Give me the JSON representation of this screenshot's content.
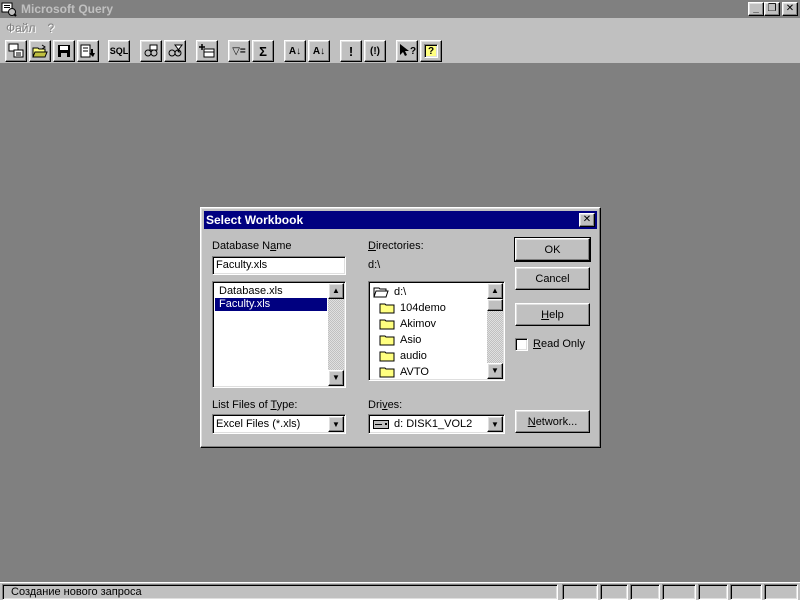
{
  "app": {
    "title": "Microsoft Query"
  },
  "window_buttons": {
    "minimize": "_",
    "restore": "❐",
    "close": "✕"
  },
  "menu": {
    "items": [
      {
        "label": "Файл"
      },
      {
        "label": "?"
      }
    ]
  },
  "toolbar": {
    "sql_label": "SQL",
    "filter_label": "▽=",
    "sigma_label": "Σ",
    "sort_asc_label": "A↓",
    "sort_desc_label": "A↓",
    "exec_label": "!",
    "auto_label": "(!)",
    "help_pointer_label": "?",
    "help_label": "?"
  },
  "dialog": {
    "title": "Select Workbook",
    "close_glyph": "✕",
    "database_name_label_pre": "Database N",
    "database_name_label_u": "a",
    "database_name_label_post": "me",
    "database_name_value": "Faculty.xls",
    "files": [
      {
        "name": "Database.xls",
        "selected": false
      },
      {
        "name": "Faculty.xls",
        "selected": true
      }
    ],
    "directories_label_u": "D",
    "directories_label_post": "irectories:",
    "current_dir": "d:\\",
    "dir_root": "d:\\",
    "dirs": [
      "104demo",
      "Akimov",
      "Asio",
      "audio",
      "AVTO"
    ],
    "list_type_label_pre": "List Files of ",
    "list_type_label_u": "T",
    "list_type_label_post": "ype:",
    "list_type_value": "Excel Files (*.xls)",
    "drives_label_pre": "Dri",
    "drives_label_u": "v",
    "drives_label_post": "es:",
    "drive_value": "d: DISK1_VOL2",
    "ok_label": "OK",
    "cancel_label": "Cancel",
    "help_label_u": "H",
    "help_label_post": "elp",
    "read_only_label_u": "R",
    "read_only_label_post": "ead Only",
    "network_label_u": "N",
    "network_label_post": "etwork..."
  },
  "status": {
    "text": "Создание нового запроса"
  }
}
